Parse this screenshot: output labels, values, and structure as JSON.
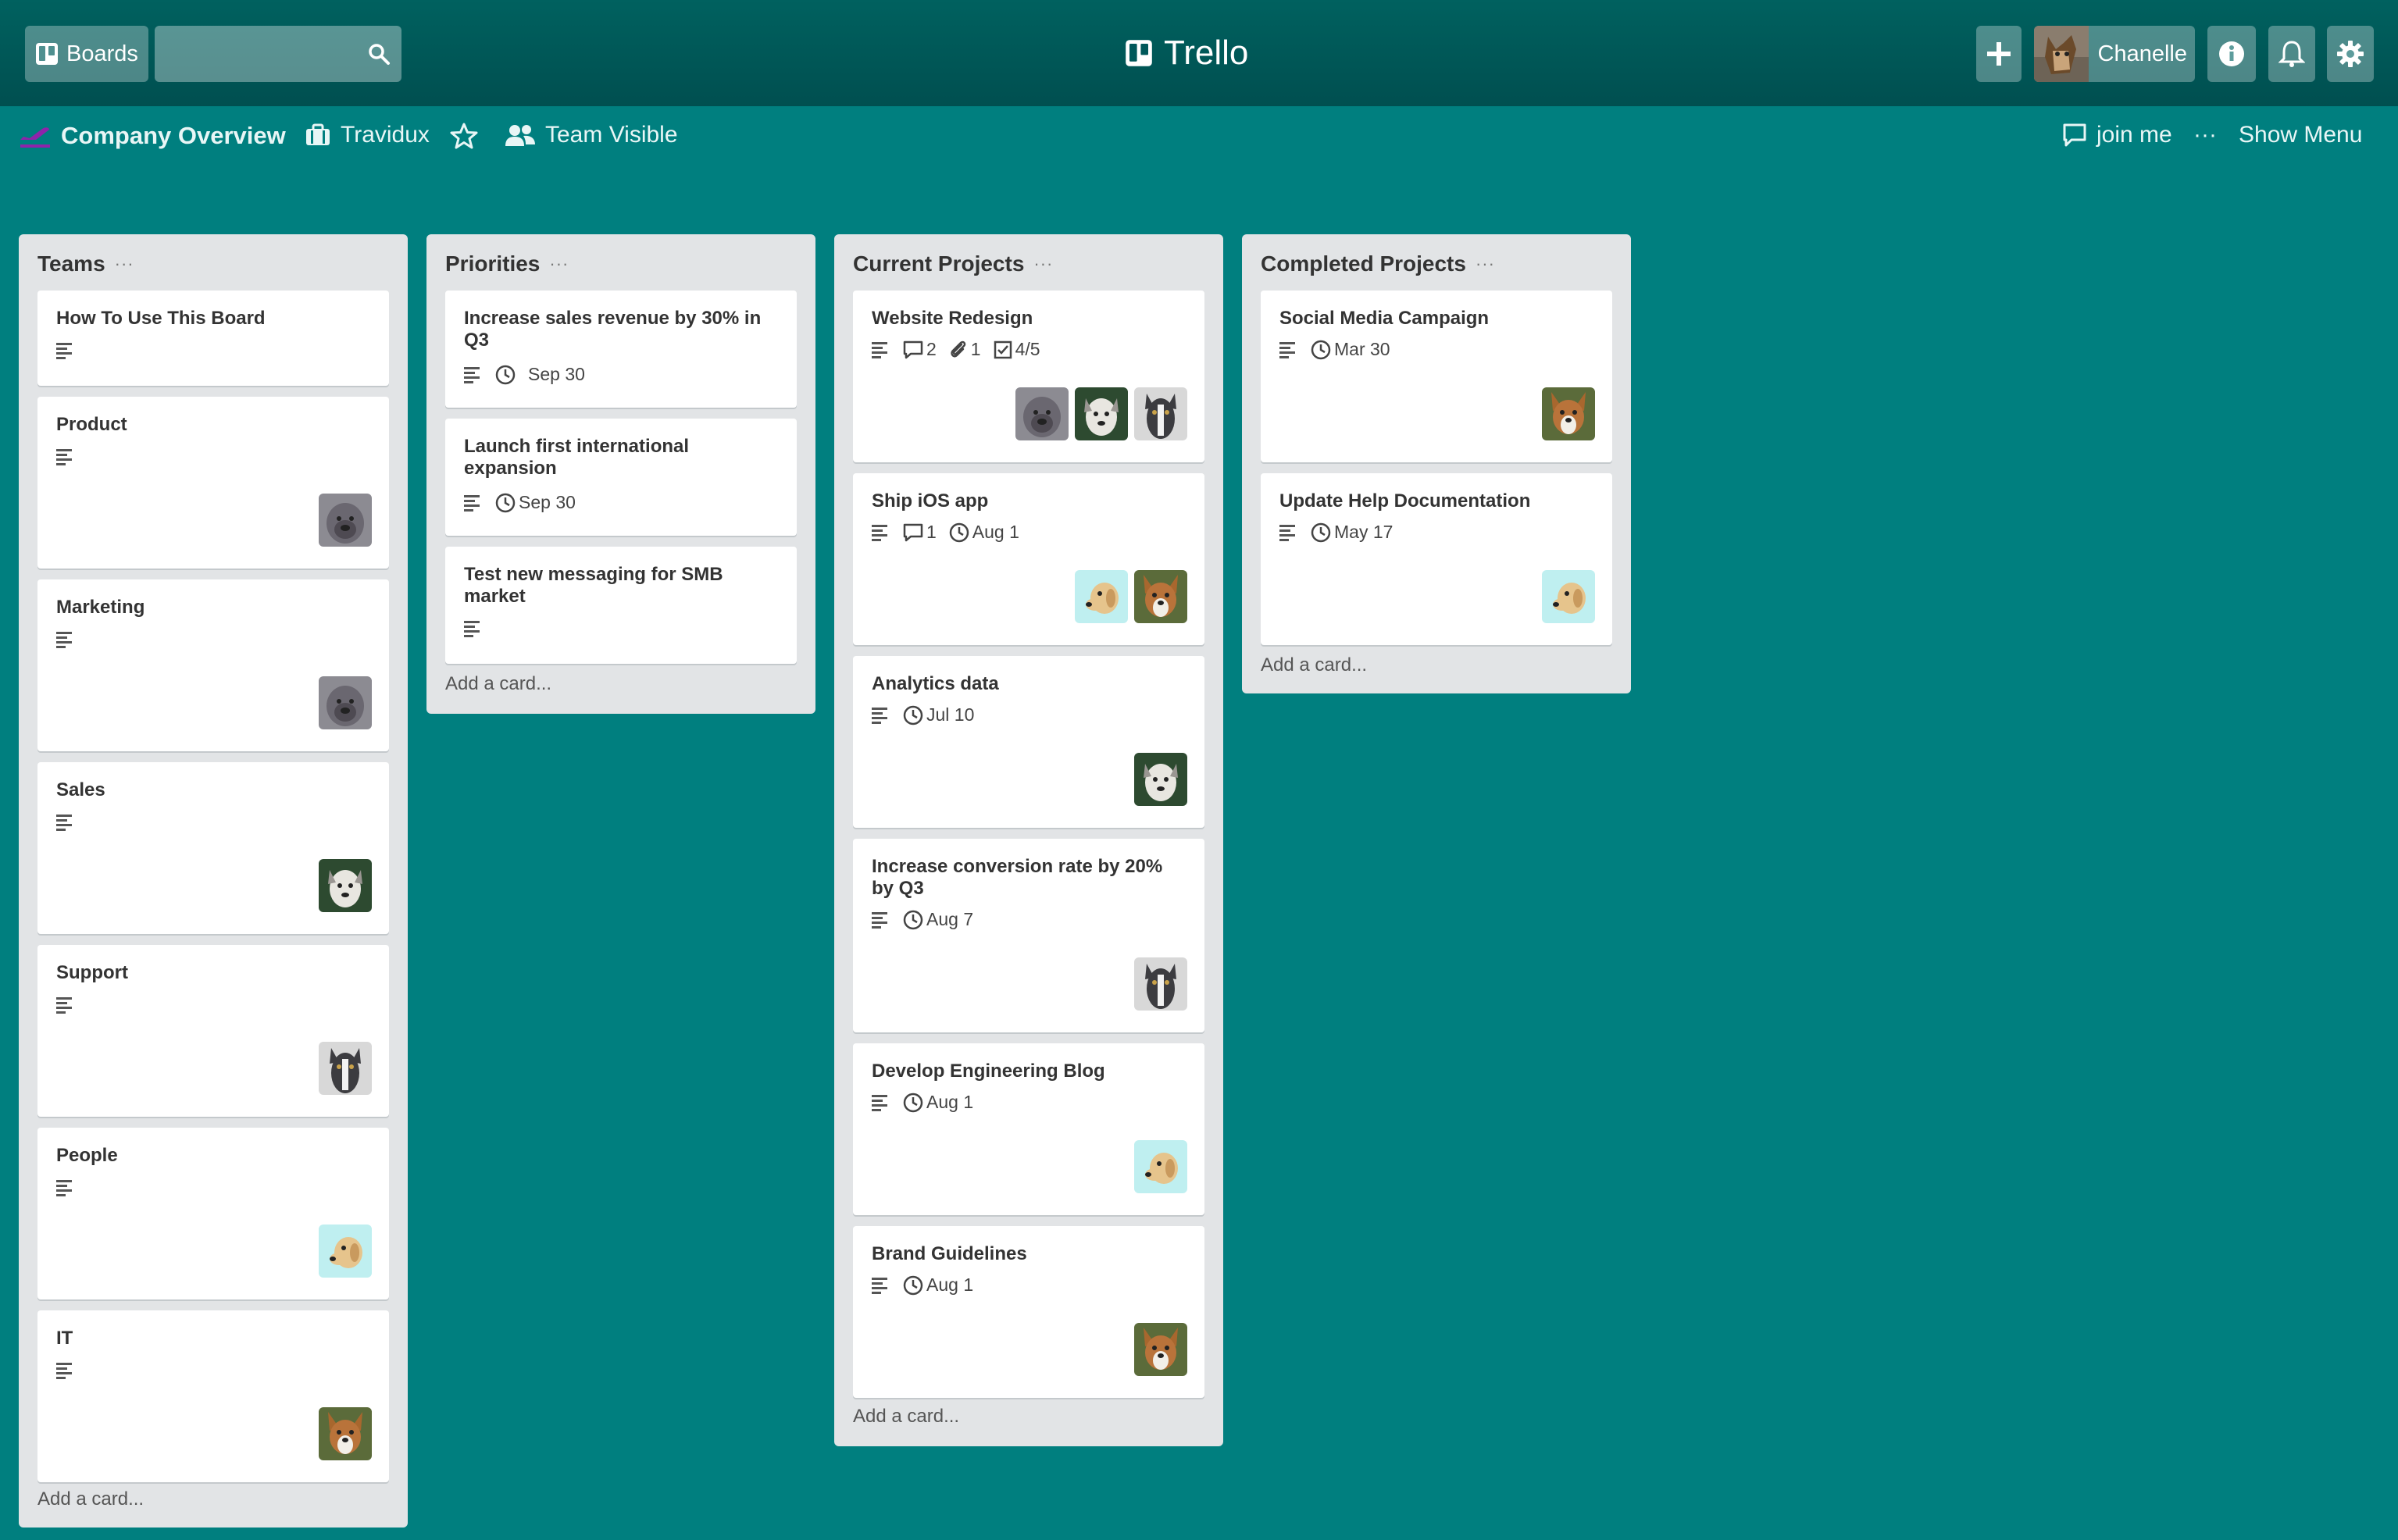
{
  "header": {
    "boards_label": "Boards",
    "app_title": "Trello",
    "user_name": "Chanelle"
  },
  "board": {
    "title": "Company Overview",
    "workspace": "Travidux",
    "visibility": "Team Visible",
    "join_label": "join me",
    "more_label": "···",
    "show_menu_label": "Show Menu"
  },
  "lists": [
    {
      "title": "Teams",
      "more": "···",
      "add_card": "Add a card...",
      "cards": [
        {
          "title": "How To Use This Board",
          "badges": [],
          "members": []
        },
        {
          "title": "Product",
          "badges": [],
          "members": [
            "bulldog"
          ]
        },
        {
          "title": "Marketing",
          "badges": [],
          "members": [
            "bulldog"
          ]
        },
        {
          "title": "Sales",
          "badges": [],
          "members": [
            "husky"
          ]
        },
        {
          "title": "Support",
          "badges": [],
          "members": [
            "pitbull"
          ]
        },
        {
          "title": "People",
          "badges": [],
          "members": [
            "lab"
          ]
        },
        {
          "title": "IT",
          "badges": [],
          "members": [
            "corgi"
          ]
        }
      ]
    },
    {
      "title": "Priorities",
      "more": "···",
      "add_card": "Add a card...",
      "cards": [
        {
          "title": "Increase sales revenue by 30% in Q3",
          "badges": [
            {
              "icon": "clock-icon",
              "text": "Sep 30"
            }
          ],
          "members": []
        },
        {
          "title": "Launch first international expansion",
          "badges": [
            {
              "icon": "clock-icon",
              "text": "Sep 30"
            }
          ],
          "members": []
        },
        {
          "title": "Test new messaging for SMB market",
          "badges": [],
          "members": []
        }
      ]
    },
    {
      "title": "Current Projects",
      "more": "···",
      "add_card": "Add a card...",
      "cards": [
        {
          "title": "Website Redesign",
          "badges": [
            {
              "icon": "comment-icon",
              "text": "2"
            },
            {
              "icon": "paperclip-icon",
              "text": "1"
            },
            {
              "icon": "checklist-icon",
              "text": "4/5"
            }
          ],
          "members": [
            "bulldog",
            "husky",
            "pitbull"
          ]
        },
        {
          "title": "Ship iOS app",
          "badges": [
            {
              "icon": "comment-icon",
              "text": "1"
            },
            {
              "icon": "clock-icon",
              "text": "Aug 1"
            }
          ],
          "members": [
            "lab",
            "corgi"
          ]
        },
        {
          "title": "Analytics data",
          "badges": [
            {
              "icon": "clock-icon",
              "text": "Jul 10"
            }
          ],
          "members": [
            "husky"
          ]
        },
        {
          "title": "Increase conversion rate by 20% by Q3",
          "badges": [
            {
              "icon": "clock-icon",
              "text": "Aug 7"
            }
          ],
          "members": [
            "pitbull"
          ]
        },
        {
          "title": "Develop Engineering Blog",
          "badges": [
            {
              "icon": "clock-icon",
              "text": "Aug 1"
            }
          ],
          "members": [
            "lab"
          ]
        },
        {
          "title": "Brand Guidelines",
          "badges": [
            {
              "icon": "clock-icon",
              "text": "Aug 1"
            }
          ],
          "members": [
            "corgi"
          ]
        }
      ]
    },
    {
      "title": "Completed Projects",
      "more": "···",
      "add_card": "Add a card...",
      "cards": [
        {
          "title": "Social Media Campaign",
          "badges": [
            {
              "icon": "clock-icon",
              "text": "Mar 30"
            }
          ],
          "members": [
            "corgi"
          ]
        },
        {
          "title": "Update Help Documentation",
          "badges": [
            {
              "icon": "clock-icon",
              "text": "May 17"
            }
          ],
          "members": [
            "lab"
          ]
        }
      ]
    }
  ],
  "colors": {
    "board_background": "#007f7f",
    "header_background": "#00585a",
    "list_background": "#e2e4e6",
    "card_background": "#ffffff"
  }
}
